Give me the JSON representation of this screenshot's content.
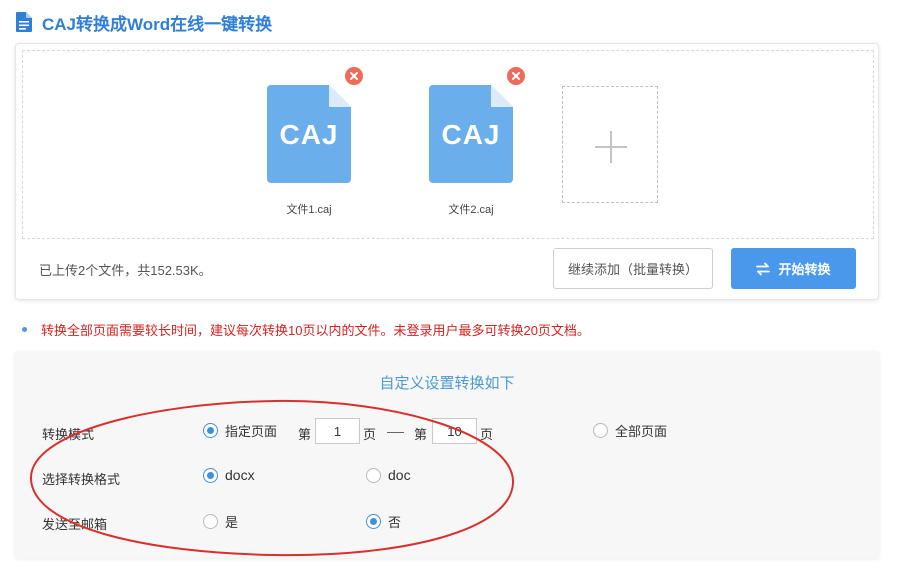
{
  "header": {
    "title": "CAJ转换成Word在线一键转换",
    "icon": "document-icon",
    "color": "#2f7fd6"
  },
  "upload": {
    "files": [
      {
        "ext": "CAJ",
        "name": "文件1.caj"
      },
      {
        "ext": "CAJ",
        "name": "文件2.caj"
      }
    ],
    "add_icon": "plus-icon",
    "summary": "已上传2个文件，共152.53K。",
    "continue_label": "继续添加（批量转换）",
    "start_label": "开始转换",
    "start_icon": "swap-arrows-icon",
    "accent": "#4a98ec",
    "file_color": "#6aaeec",
    "remove_color": "#ef6a5a"
  },
  "notice": {
    "text": "转换全部页面需要较长时间，建议每次转换10页以内的文件。未登录用户最多可转换20页文档。",
    "color": "#d8211f"
  },
  "settings": {
    "title": "自定义设置转换如下",
    "mode": {
      "label": "转换模式",
      "specific_label": "指定页面",
      "specific_checked": true,
      "page_prefix": "第",
      "page_suffix": "页",
      "from_value": "1",
      "to_value": "10",
      "all_label": "全部页面",
      "all_checked": false
    },
    "format": {
      "label": "选择转换格式",
      "options": [
        {
          "label": "docx",
          "checked": true
        },
        {
          "label": "doc",
          "checked": false
        }
      ]
    },
    "email": {
      "label": "发送至邮箱",
      "options": [
        {
          "label": "是",
          "checked": false
        },
        {
          "label": "否",
          "checked": true
        }
      ]
    }
  },
  "annotation": {
    "shape": "ellipse",
    "color": "#d9302c"
  }
}
